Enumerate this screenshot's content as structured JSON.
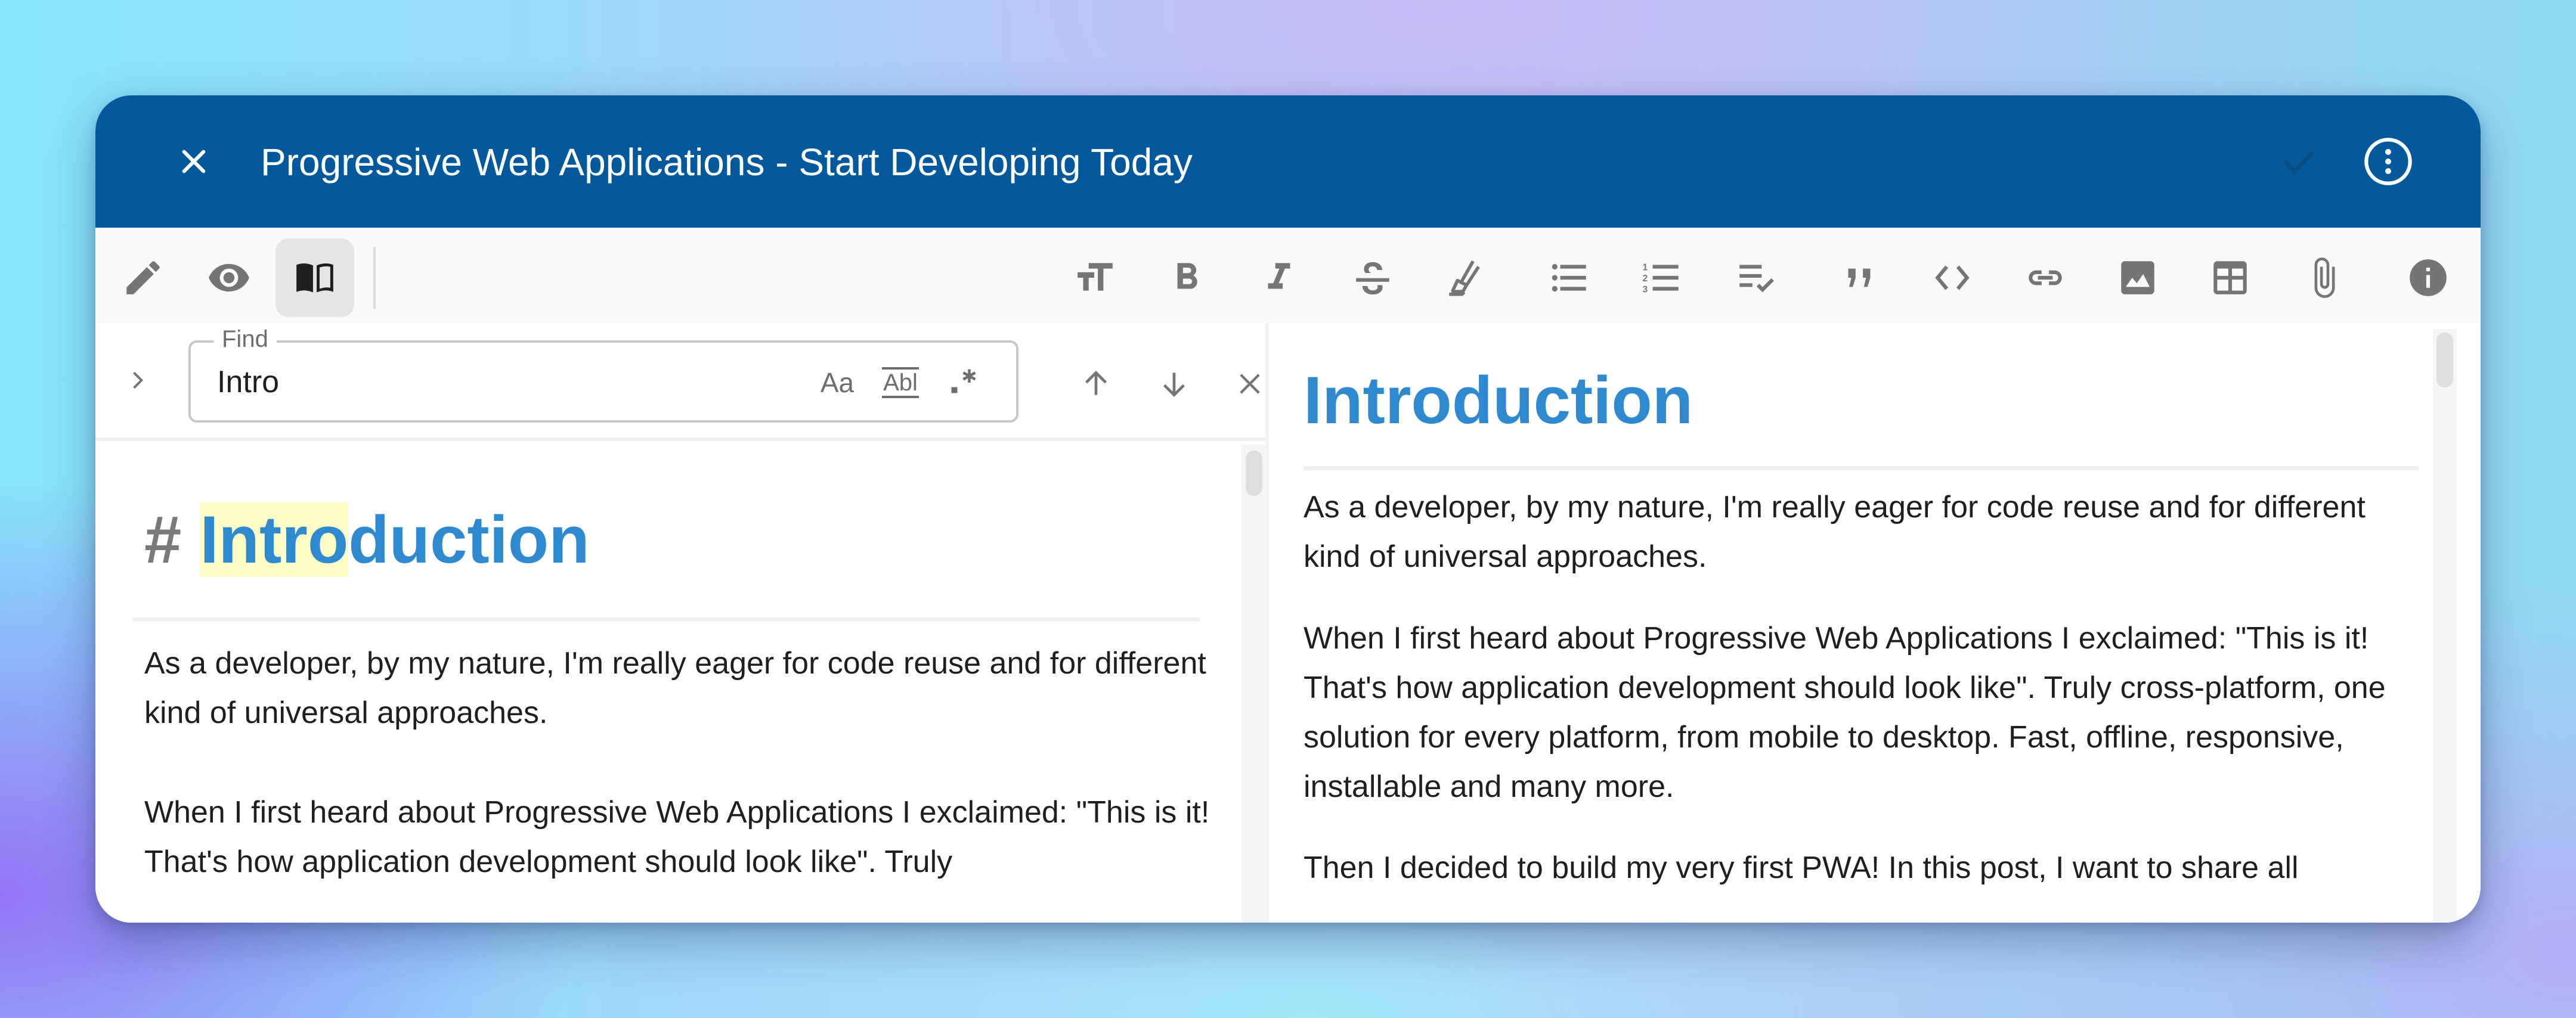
{
  "header": {
    "title": "Progressive Web Applications - Start Developing Today",
    "close_icon": "close-icon",
    "save_icon": "check-icon",
    "more_icon": "more-vertical-circle-icon",
    "bg_color": "#03599c"
  },
  "toolbar": {
    "view_modes": [
      {
        "name": "edit",
        "icon": "pencil-icon",
        "active": false
      },
      {
        "name": "preview",
        "icon": "eye-icon",
        "active": false
      },
      {
        "name": "side-by-side",
        "icon": "book-open-icon",
        "active": true
      }
    ],
    "format_buttons": [
      {
        "name": "heading",
        "icon": "text-size-icon"
      },
      {
        "name": "bold",
        "icon": "bold-icon"
      },
      {
        "name": "italic",
        "icon": "italic-icon"
      },
      {
        "name": "strikethrough",
        "icon": "strikethrough-icon"
      },
      {
        "name": "highlight",
        "icon": "highlighter-icon"
      },
      {
        "name": "bullet-list",
        "icon": "bulleted-list-icon"
      },
      {
        "name": "numbered-list",
        "icon": "numbered-list-icon"
      },
      {
        "name": "task-list",
        "icon": "checklist-icon"
      },
      {
        "name": "blockquote",
        "icon": "quote-icon"
      },
      {
        "name": "code",
        "icon": "code-icon"
      },
      {
        "name": "link",
        "icon": "link-icon"
      },
      {
        "name": "image",
        "icon": "image-icon"
      },
      {
        "name": "table",
        "icon": "table-icon"
      },
      {
        "name": "attachment",
        "icon": "paperclip-icon"
      },
      {
        "name": "info",
        "icon": "info-icon"
      }
    ]
  },
  "find": {
    "label": "Find",
    "value": "Intro",
    "match_case_label": "Aa",
    "whole_word_label": "Abl",
    "regex_label": ".*"
  },
  "editor": {
    "heading_marker": "#",
    "heading_match": "Intro",
    "heading_rest": "duction",
    "paragraphs": [
      "As a developer, by my nature, I'm really eager for code reuse and for different kind of universal approaches.",
      "When I first heard about Progressive Web Applications I exclaimed: \"This is it! That's how application development should look like\". Truly"
    ],
    "match_highlight_color": "#fdfdc6",
    "heading_color": "#2f89cf"
  },
  "preview": {
    "heading": "Introduction",
    "paragraphs": [
      "As a developer, by my nature, I'm really eager for code reuse and for different kind of universal approaches.",
      "When I first heard about Progressive Web Applications I exclaimed: \"This is it! That's how application development should look like\". Truly cross-platform, one solution for every platform, from mobile to desktop. Fast, offline, responsive, installable and many more.",
      "Then I decided to build my very first PWA! In this post, I want to share all"
    ]
  }
}
